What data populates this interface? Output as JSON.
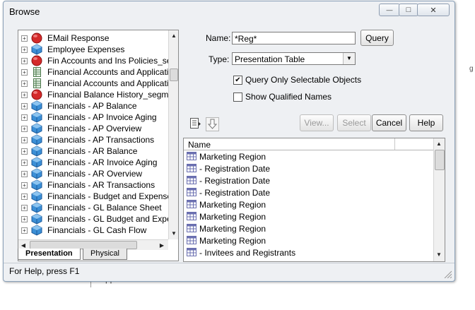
{
  "background": {
    "behind_text": "Application Ro",
    "behind_right_text": "g"
  },
  "window": {
    "title": "Browse",
    "minimize_glyph": "—",
    "maximize_glyph": "□",
    "close_glyph": "✕"
  },
  "tree": {
    "items": [
      {
        "label": "EMail Response",
        "icon": "red-circle-icon"
      },
      {
        "label": "Employee Expenses",
        "icon": "blue-cube-icon"
      },
      {
        "label": "Fin Accounts and Ins Policies_segm",
        "icon": "red-circle-icon"
      },
      {
        "label": "Financial Accounts and Applicati...",
        "icon": "table-sheet-icon"
      },
      {
        "label": "Financial Accounts and Applications",
        "icon": "table-sheet-icon"
      },
      {
        "label": "Financial Balance History_segmenta",
        "icon": "red-circle-icon"
      },
      {
        "label": "Financials - AP Balance",
        "icon": "blue-cube-icon"
      },
      {
        "label": "Financials - AP Invoice Aging",
        "icon": "blue-cube-icon"
      },
      {
        "label": "Financials - AP Overview",
        "icon": "blue-cube-icon"
      },
      {
        "label": "Financials - AP Transactions",
        "icon": "blue-cube-icon"
      },
      {
        "label": "Financials - AR Balance",
        "icon": "blue-cube-icon"
      },
      {
        "label": "Financials - AR Invoice Aging",
        "icon": "blue-cube-icon"
      },
      {
        "label": "Financials - AR Overview",
        "icon": "blue-cube-icon"
      },
      {
        "label": "Financials - AR Transactions",
        "icon": "blue-cube-icon"
      },
      {
        "label": "Financials - Budget and Expenses (l",
        "icon": "blue-cube-icon"
      },
      {
        "label": "Financials - GL Balance Sheet",
        "icon": "blue-cube-icon"
      },
      {
        "label": "Financials - GL Budget and Expen...",
        "icon": "blue-cube-icon"
      },
      {
        "label": "Financials - GL Cash Flow",
        "icon": "blue-cube-icon"
      }
    ],
    "tabs": [
      "Presentation",
      "Physical"
    ]
  },
  "form": {
    "name_label": "Name:",
    "name_value": "*Reg*",
    "query_button": "Query",
    "type_label": "Type:",
    "type_value": "Presentation Table",
    "query_selectable_label": "Query Only Selectable Objects",
    "query_selectable_checked": true,
    "show_qualified_label": "Show Qualified Names",
    "show_qualified_checked": false
  },
  "buttons": {
    "view": "View...",
    "select": "Select",
    "cancel": "Cancel",
    "help": "Help"
  },
  "results": {
    "column_header": "Name",
    "rows": [
      "Marketing Region",
      "- Registration Date",
      "- Registration Date",
      "- Registration Date",
      "Marketing Region",
      "Marketing Region",
      "Marketing Region",
      "Marketing Region",
      "- Invitees and Registrants"
    ]
  },
  "status": {
    "text": "For Help, press F1"
  },
  "colors": {
    "window_bg": "#eef0f3",
    "red_icon": "#d42a2a",
    "blue_icon": "#3b8fd6",
    "grid_icon": "#6a6fb0"
  }
}
